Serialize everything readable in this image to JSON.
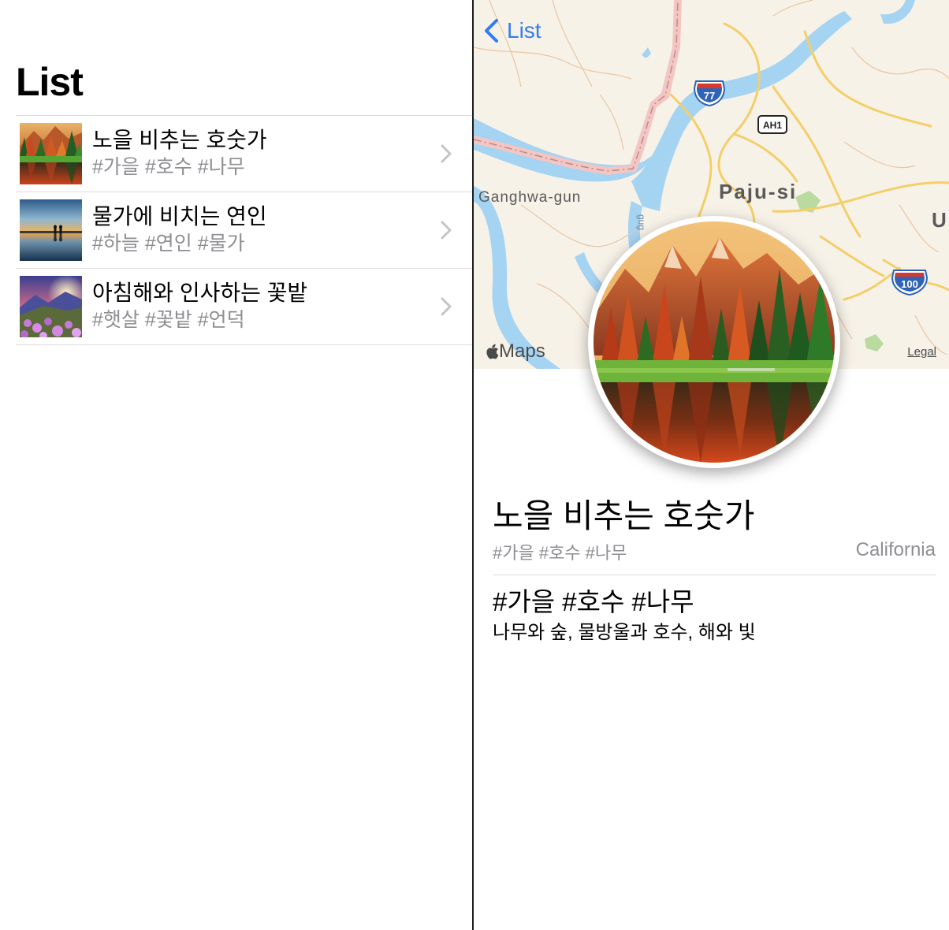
{
  "master": {
    "title": "List",
    "items": [
      {
        "title": "노을 비추는 호숫가",
        "tags": "#가을 #호수 #나무",
        "thumbnail": "autumn-lake-forest"
      },
      {
        "title": "물가에 비치는 연인",
        "tags": "#하늘 #연인 #물가",
        "thumbnail": "couple-reflection-sunset"
      },
      {
        "title": "아침해와 인사하는 꽃밭",
        "tags": "#햇살 #꽃밭 #언덕",
        "thumbnail": "sunrise-flower-hill"
      }
    ]
  },
  "detail": {
    "back_label": "List",
    "map": {
      "labels": {
        "ganghwa": "Ganghwa-gun",
        "paju": "Paju-si",
        "u": "U",
        "gug": "gug"
      },
      "shields": {
        "route77": "77",
        "ah1": "AH1",
        "route100": "100"
      },
      "brand": "Maps",
      "legal": "Legal"
    },
    "title": "노을 비추는 호숫가",
    "tags": "#가을 #호수 #나무",
    "location": "California",
    "hashtags": "#가을 #호수 #나무",
    "description": "나무와 숲, 물방울과 호수, 해와 빛"
  },
  "colors": {
    "accent": "#2f7cf6",
    "secondary_text": "#8e8e93",
    "separator": "#dcdcdc",
    "map_water": "#a5d3f2",
    "map_road": "#f3cf6a"
  }
}
